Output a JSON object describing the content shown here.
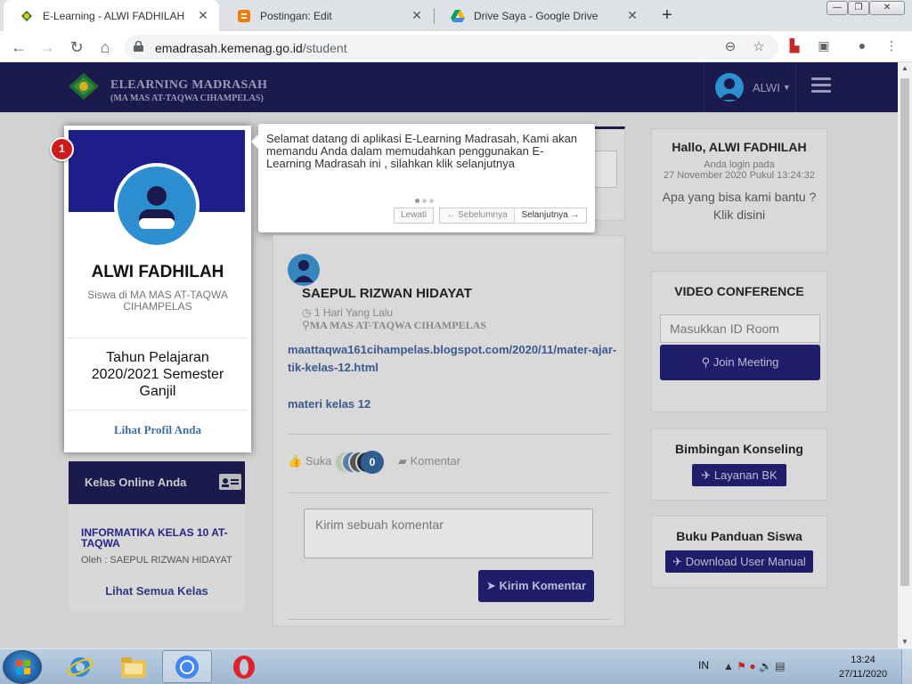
{
  "browser": {
    "tabs": [
      {
        "title": "E-Learning - ALWI FADHILAH",
        "active": true
      },
      {
        "title": "Postingan: Edit",
        "active": false
      },
      {
        "title": "Drive Saya - Google Drive",
        "active": false
      }
    ],
    "url_host": "emadrasah.kemenag.go.id",
    "url_path": "/student"
  },
  "site": {
    "name_line1": "ELEARNING MADRASAH",
    "name_line2": "(MA MAS AT-TAQWA CIHAMPELAS)",
    "user_label": "ALWI"
  },
  "profile": {
    "badge": "1",
    "name": "ALWI FADHILAH",
    "role": "Siswa di MA MAS AT-TAQWA CIHAMPELAS",
    "year": "Tahun Pelajaran 2020/2021 Semester Ganjil",
    "link": "Lihat Profil Anda"
  },
  "kelas": {
    "heading": "Kelas Online Anda",
    "course": "INFORMATIKA KELAS 10 AT-TAQWA",
    "by": "Oleh : SAEPUL RIZWAN HIDAYAT",
    "see_all": "Lihat Semua Kelas"
  },
  "tour": {
    "message": "Selamat datang di aplikasi E-Learning Madrasah, Kami akan memandu Anda dalam memudahkan penggunakan E-Learning Madrasah ini , silahkan klik selanjutnya",
    "skip": "Lewati",
    "prev": "← Sebelumnya",
    "next": "Selanjutnya →"
  },
  "post": {
    "author": "SAEPUL RIZWAN HIDAYAT",
    "time": "1 Hari Yang Lalu",
    "place": "MA MAS AT-TAQWA CIHAMPELAS",
    "link": "maattaqwa161cihampelas.blogspot.com/2020/11/mater-ajar-tik-kelas-12.html",
    "title": "materi kelas 12",
    "like_label": "Suka",
    "like_count": "0",
    "comment_label": "Komentar",
    "comment_placeholder": "Kirim sebuah komentar",
    "send_label": "Kirim Komentar"
  },
  "sidebar": {
    "hallo": "Hallo, ALWI FADHILAH",
    "login_line1": "Anda login pada",
    "login_line2": "27 November 2020 Pukul 13:24:32",
    "help": "Apa yang bisa kami bantu ? Klik disini",
    "video_title": "VIDEO CONFERENCE",
    "room_placeholder": "Masukkan ID Room",
    "join_label": "Join Meeting",
    "bk_title": "Bimbingan Konseling",
    "bk_button": "Layanan BK",
    "buku_title": "Buku Panduan Siswa",
    "buku_button": "Download User Manual"
  },
  "taskbar": {
    "lang": "IN",
    "time": "13:24",
    "date": "27/11/2020"
  },
  "colors": {
    "header": "#1a1a4d",
    "banner": "#1e1e8a",
    "button": "#1e1e6a",
    "badge": "#cf1b1b",
    "avatar": "#2e8fd0"
  }
}
